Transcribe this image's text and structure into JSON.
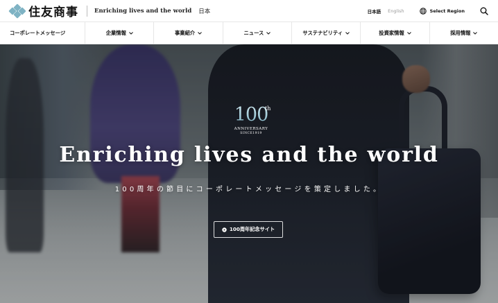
{
  "header": {
    "logo_text": "住友商事",
    "tagline": "Enriching lives and the world",
    "country": "日本",
    "lang_ja": "日本語",
    "lang_en": "English",
    "region_label": "Select Region",
    "search_icon": "search-icon",
    "globe_icon": "globe-icon"
  },
  "nav": {
    "items": [
      {
        "label": "コーポレートメッセージ",
        "has_dropdown": false
      },
      {
        "label": "企業情報",
        "has_dropdown": true
      },
      {
        "label": "事業紹介",
        "has_dropdown": true
      },
      {
        "label": "ニュース",
        "has_dropdown": true
      },
      {
        "label": "サステナビリティ",
        "has_dropdown": true
      },
      {
        "label": "投資家情報",
        "has_dropdown": true
      },
      {
        "label": "採用情報",
        "has_dropdown": true
      }
    ]
  },
  "hero": {
    "anniversary_number": "100",
    "anniversary_suffix": "th",
    "anniversary_label": "ANNIVERSARY",
    "anniversary_since": "SINCE1919",
    "headline": "Enriching lives and the world",
    "subhead": "100周年の節目にコーポレートメッセージを策定しました。",
    "cta_label": "100周年記念サイト",
    "cta_icon": "play-circle-icon"
  },
  "colors": {
    "logo_accent": "#7fb3c4",
    "nav_border": "#e6e6e6",
    "text_dark": "#111111",
    "text_muted": "#999999"
  }
}
